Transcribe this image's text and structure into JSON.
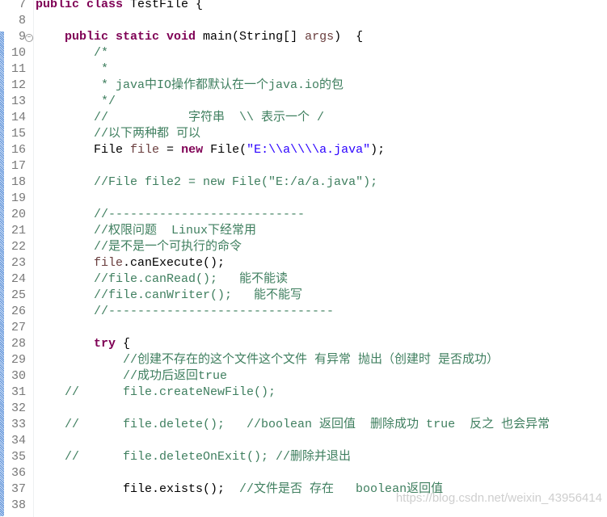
{
  "editor": {
    "colors": {
      "keyword": "#7f0055",
      "comment": "#3f7f5f",
      "string": "#2a00ff",
      "variable": "#6a3e3e",
      "line_number": "#787878"
    },
    "fold_icon_line": 9,
    "lines": [
      {
        "n": "7",
        "tokens": [
          {
            "t": "public class",
            "c": "kw"
          },
          {
            "t": " TestFile {",
            "c": ""
          }
        ]
      },
      {
        "n": "8",
        "tokens": []
      },
      {
        "n": "9",
        "tokens": [
          {
            "t": "    ",
            "c": ""
          },
          {
            "t": "public static void",
            "c": "kw"
          },
          {
            "t": " main(String[] ",
            "c": ""
          },
          {
            "t": "args",
            "c": "var"
          },
          {
            "t": ")  {",
            "c": ""
          }
        ]
      },
      {
        "n": "10",
        "tokens": [
          {
            "t": "        /*",
            "c": "cm"
          }
        ]
      },
      {
        "n": "11",
        "tokens": [
          {
            "t": "         *",
            "c": "cm"
          }
        ]
      },
      {
        "n": "12",
        "tokens": [
          {
            "t": "         * java中IO操作都默认在一个java.io的包",
            "c": "cm"
          }
        ]
      },
      {
        "n": "13",
        "tokens": [
          {
            "t": "         */",
            "c": "cm"
          }
        ]
      },
      {
        "n": "14",
        "tokens": [
          {
            "t": "        //           字符串  \\\\ 表示一个 /",
            "c": "cm"
          }
        ]
      },
      {
        "n": "15",
        "tokens": [
          {
            "t": "        //以下两种都 可以",
            "c": "cm"
          }
        ]
      },
      {
        "n": "16",
        "tokens": [
          {
            "t": "        File ",
            "c": ""
          },
          {
            "t": "file",
            "c": "var"
          },
          {
            "t": " = ",
            "c": ""
          },
          {
            "t": "new",
            "c": "kw"
          },
          {
            "t": " File(",
            "c": ""
          },
          {
            "t": "\"E:\\\\a\\\\\\\\a.java\"",
            "c": "str"
          },
          {
            "t": ");",
            "c": ""
          }
        ]
      },
      {
        "n": "17",
        "tokens": []
      },
      {
        "n": "18",
        "tokens": [
          {
            "t": "        //File file2 = new File(\"E:/a/a.java\");",
            "c": "cm"
          }
        ]
      },
      {
        "n": "19",
        "tokens": []
      },
      {
        "n": "20",
        "tokens": [
          {
            "t": "        //---------------------------",
            "c": "cm"
          }
        ]
      },
      {
        "n": "21",
        "tokens": [
          {
            "t": "        //权限问题  Linux下经常用",
            "c": "cm"
          }
        ]
      },
      {
        "n": "22",
        "tokens": [
          {
            "t": "        //是不是一个可执行的命令",
            "c": "cm"
          }
        ]
      },
      {
        "n": "23",
        "tokens": [
          {
            "t": "        ",
            "c": ""
          },
          {
            "t": "file",
            "c": "var"
          },
          {
            "t": ".canExecute();",
            "c": ""
          }
        ]
      },
      {
        "n": "24",
        "tokens": [
          {
            "t": "        //file.canRead();   能不能读",
            "c": "cm"
          }
        ]
      },
      {
        "n": "25",
        "tokens": [
          {
            "t": "        //file.canWriter();   能不能写",
            "c": "cm"
          }
        ]
      },
      {
        "n": "26",
        "tokens": [
          {
            "t": "        //-------------------------------",
            "c": "cm"
          }
        ]
      },
      {
        "n": "27",
        "tokens": []
      },
      {
        "n": "28",
        "tokens": [
          {
            "t": "        ",
            "c": ""
          },
          {
            "t": "try",
            "c": "kw"
          },
          {
            "t": " {",
            "c": ""
          }
        ]
      },
      {
        "n": "29",
        "tokens": [
          {
            "t": "            //创建不存在的这个文件这个文件 有异常 抛出（创建时 是否成功）",
            "c": "cm"
          }
        ]
      },
      {
        "n": "30",
        "tokens": [
          {
            "t": "            //成功后返回true",
            "c": "cm"
          }
        ]
      },
      {
        "n": "31",
        "tokens": [
          {
            "t": "    //      file.createNewFile();",
            "c": "cm"
          }
        ]
      },
      {
        "n": "32",
        "tokens": []
      },
      {
        "n": "33",
        "tokens": [
          {
            "t": "    //      file.delete();   //boolean 返回值  删除成功 true  反之 也会异常",
            "c": "cm"
          }
        ]
      },
      {
        "n": "34",
        "tokens": []
      },
      {
        "n": "35",
        "tokens": [
          {
            "t": "    //      file.deleteOnExit(); //删除并退出",
            "c": "cm"
          }
        ]
      },
      {
        "n": "36",
        "tokens": []
      },
      {
        "n": "37",
        "tokens": [
          {
            "t": "            file.exists();  ",
            "c": ""
          },
          {
            "t": "//文件是否 存在   boolean返回值",
            "c": "cm"
          }
        ]
      },
      {
        "n": "38",
        "tokens": []
      }
    ]
  },
  "watermark": "https://blog.csdn.net/weixin_43956414"
}
